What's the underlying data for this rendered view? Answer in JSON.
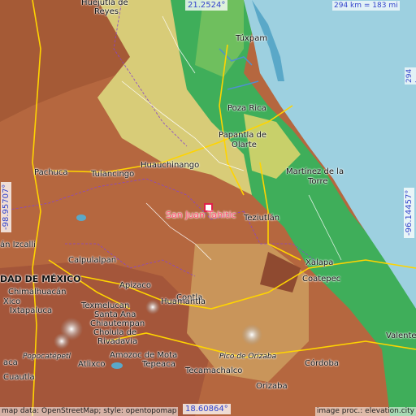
{
  "coords": {
    "top": "21.2524°",
    "bottom": "18.60864°",
    "left": "-98.95707°",
    "right": "-96.14457°"
  },
  "scale": {
    "horizontal": "294 km = 183 mi",
    "vertical": "294 km = 183 mi"
  },
  "focus": {
    "name": "San Juan Tahitic",
    "color": "#e0204a"
  },
  "places": [
    {
      "id": "huejutla",
      "text": "Huejutla de"
    },
    {
      "id": "reyes",
      "text": "Reyes"
    },
    {
      "id": "tuxpam",
      "text": "Túxpam"
    },
    {
      "id": "pozarica",
      "text": "Poza Rica"
    },
    {
      "id": "papantla",
      "text": "Papantla de"
    },
    {
      "id": "olarte",
      "text": "Olarte"
    },
    {
      "id": "huauchinango",
      "text": "Huauchinango"
    },
    {
      "id": "pachuca",
      "text": "Pachuca"
    },
    {
      "id": "tulancingo",
      "text": "Tulancingo"
    },
    {
      "id": "martinez",
      "text": "Martínez de la"
    },
    {
      "id": "torre",
      "text": "Torre"
    },
    {
      "id": "teziutlan",
      "text": "Teziutlán"
    },
    {
      "id": "izcalli",
      "text": "án Izcalli"
    },
    {
      "id": "calpulalpan",
      "text": "Calpulalpan"
    },
    {
      "id": "cdmx",
      "text": "DAD DE MÉXICO"
    },
    {
      "id": "chimalhuacan",
      "text": "Chimalhuacán"
    },
    {
      "id": "xico",
      "text": "Xico"
    },
    {
      "id": "ixtapaluca",
      "text": "Ixtapaluca"
    },
    {
      "id": "apizaco",
      "text": "Apizaco"
    },
    {
      "id": "contla",
      "text": "Contla"
    },
    {
      "id": "texmelucan",
      "text": "Texmelucan"
    },
    {
      "id": "santaana",
      "text": "Santa Ana"
    },
    {
      "id": "chiautempan",
      "text": "Chiautempan"
    },
    {
      "id": "huamantla",
      "text": "Huamantla"
    },
    {
      "id": "cholula",
      "text": "Cholula de"
    },
    {
      "id": "rivadavia",
      "text": "Rivadavia"
    },
    {
      "id": "xalapa",
      "text": "Xalapa"
    },
    {
      "id": "coatepec",
      "text": "Coatepec"
    },
    {
      "id": "valente",
      "text": "Valente D"
    },
    {
      "id": "cordoba",
      "text": "Córdoba"
    },
    {
      "id": "orizaba",
      "text": "Orizaba"
    },
    {
      "id": "tecamachalco",
      "text": "Tecamachalco"
    },
    {
      "id": "tepeaca",
      "text": "Tepeaca"
    },
    {
      "id": "amozoc",
      "text": "Amozoc de Mota"
    },
    {
      "id": "atlixco",
      "text": "Atlixco"
    },
    {
      "id": "acaya",
      "text": "aca"
    },
    {
      "id": "cuautla",
      "text": "Cuautla"
    },
    {
      "id": "popo",
      "text": "Popocatépetl"
    },
    {
      "id": "pico",
      "text": "Pico de Orizaba"
    }
  ],
  "credits": {
    "left": "map data: OpenStreetMap; style: opentopomap",
    "right": "image proc.: elevation.city"
  },
  "colors": {
    "sea": "#9dd0e0",
    "lowland": "#3fae5a",
    "hills": "#d9d27a",
    "mountains": "#b8603c",
    "peaks": "#f2f2f2",
    "roads": "#ffd400"
  }
}
